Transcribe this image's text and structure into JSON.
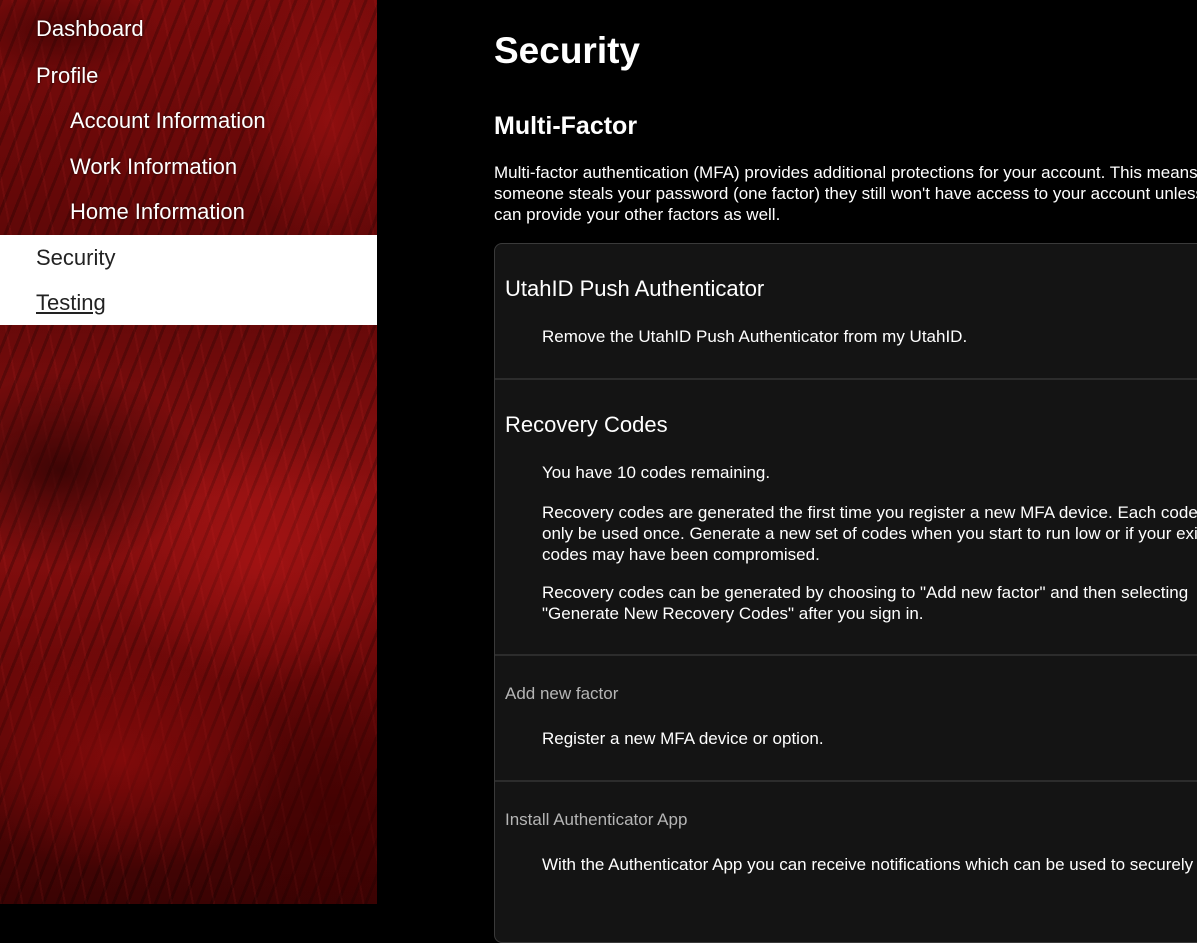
{
  "sidebar": {
    "items": [
      {
        "label": "Dashboard"
      },
      {
        "label": "Profile"
      },
      {
        "label": "Account Information"
      },
      {
        "label": "Work Information"
      },
      {
        "label": "Home Information"
      },
      {
        "label": "Security"
      },
      {
        "label": "Testing"
      }
    ]
  },
  "main": {
    "title": "Security",
    "section_title": "Multi-Factor",
    "intro": "Multi-factor authentication (MFA) provides additional protections for your account. This means that if someone steals your password (one factor) they still won't have access to your account unless they can provide your other factors as well.",
    "push": {
      "title": "UtahID Push Authenticator",
      "remove_link": "Remove the UtahID Push Authenticator from my UtahID."
    },
    "recovery": {
      "title": "Recovery Codes",
      "remaining": "You have 10 codes remaining.",
      "para1": "Recovery codes are generated the first time you register a new MFA device. Each code can only be used once. Generate a new set of codes when you start to run low or if your existing codes may have been compromised.",
      "para2": "Recovery codes can be generated by choosing to \"Add new factor\" and then selecting \"Generate New Recovery Codes\" after you sign in."
    },
    "add_factor": {
      "title": "Add new factor",
      "text": "Register a new MFA device or option."
    },
    "install_app": {
      "title": "Install Authenticator App",
      "text": "With the Authenticator App you can receive notifications which can be used to securely sign in."
    }
  }
}
